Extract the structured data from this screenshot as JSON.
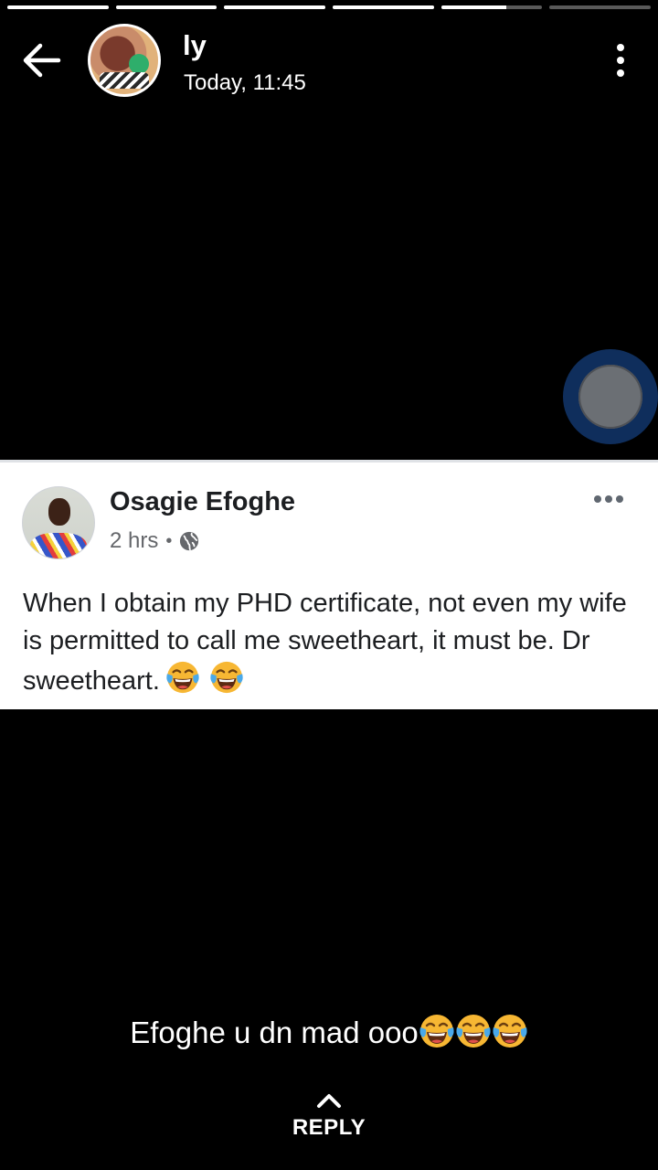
{
  "progress": {
    "segments": [
      1,
      1,
      1,
      1,
      0.64,
      0
    ]
  },
  "header": {
    "name": "ly",
    "time": "Today, 11:45"
  },
  "post": {
    "author": "Osagie Efoghe",
    "time": "2 hrs",
    "dot": "•",
    "text": "When I obtain my PHD certificate, not even my wife is permitted to call me sweetheart, it must be. Dr sweetheart.",
    "emoji_count": 2
  },
  "caption": {
    "text": "Efoghe u dn mad ooo",
    "emoji_count": 3
  },
  "reply": {
    "label": "REPLY"
  },
  "icons": {
    "back": "arrow-left-icon",
    "menu": "more-vertical-icon",
    "post_menu": "more-horizontal-icon",
    "privacy": "globe-icon",
    "emoji": "face-with-tears-of-joy-emoji",
    "reply": "chevron-up-icon"
  }
}
